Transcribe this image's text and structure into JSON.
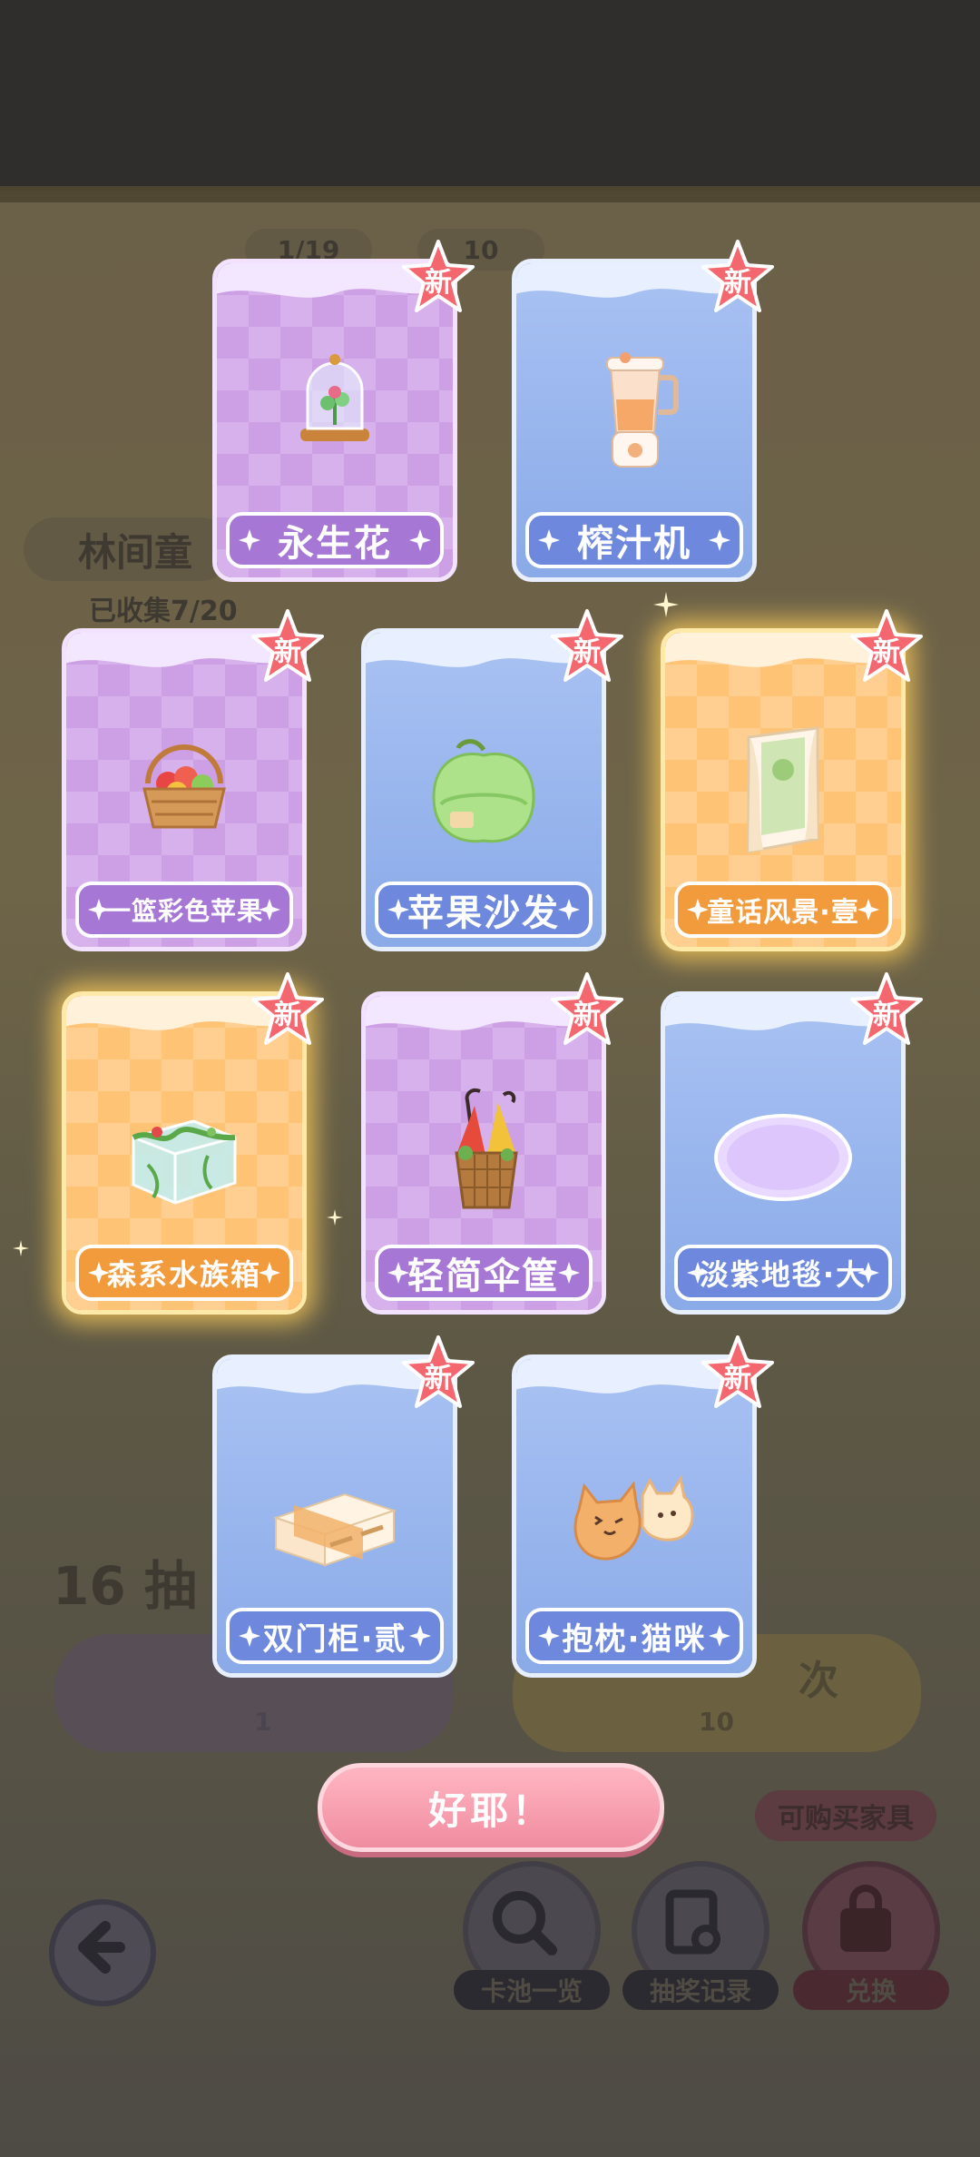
{
  "background": {
    "event_title": "林间童",
    "collected": "已收集7/20",
    "counter_a": "1/19",
    "counter_b": "10",
    "pull_count": "16 抽",
    "single_btn_cost": "1",
    "ten_btn_label": "次",
    "ten_btn_cost": "10",
    "buy_furniture_label": "可购买家具",
    "nav_pool_label": "卡池一览",
    "nav_record_label": "抽奖记录",
    "nav_exchange_label": "兑换"
  },
  "new_badge_label": "新",
  "cards": [
    {
      "name": "永生花",
      "theme": "purple",
      "icon": "glass-dome-flower-icon"
    },
    {
      "name": "榨汁机",
      "theme": "blue",
      "icon": "juicer-icon"
    },
    {
      "name": "一篮彩色苹果",
      "theme": "purple",
      "icon": "apple-basket-icon"
    },
    {
      "name": "苹果沙发",
      "theme": "blue",
      "icon": "apple-sofa-icon"
    },
    {
      "name": "童话风景·壹",
      "theme": "orange",
      "icon": "window-curtain-icon"
    },
    {
      "name": "森系水族箱",
      "theme": "orange",
      "icon": "aquarium-icon"
    },
    {
      "name": "轻简伞筐",
      "theme": "purple",
      "icon": "umbrella-basket-icon"
    },
    {
      "name": "淡紫地毯·大",
      "theme": "blue",
      "icon": "lavender-rug-icon"
    },
    {
      "name": "双门柜·贰",
      "theme": "blue",
      "icon": "cabinet-icon"
    },
    {
      "name": "抱枕·猫咪",
      "theme": "blue",
      "icon": "cat-pillow-icon"
    }
  ],
  "confirm_label": "好耶！",
  "colors": {
    "purple": "#cda0e6",
    "blue": "#8aaae8",
    "orange": "#ffc376",
    "badge": "#f5676f",
    "confirm": "#f08ca0"
  }
}
